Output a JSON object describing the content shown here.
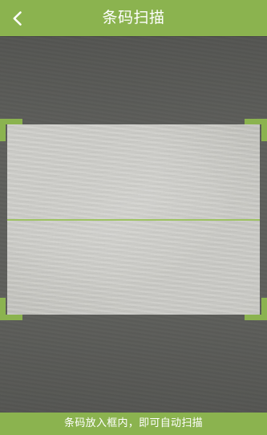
{
  "header": {
    "title": "条码扫描",
    "back_icon": "chevron-left-icon"
  },
  "scanner": {
    "hint": "条码放入框内，即可自动扫描"
  },
  "colors": {
    "accent": "#8bb34f",
    "scan_line": "#9cc25d",
    "background": "#5f605c"
  }
}
